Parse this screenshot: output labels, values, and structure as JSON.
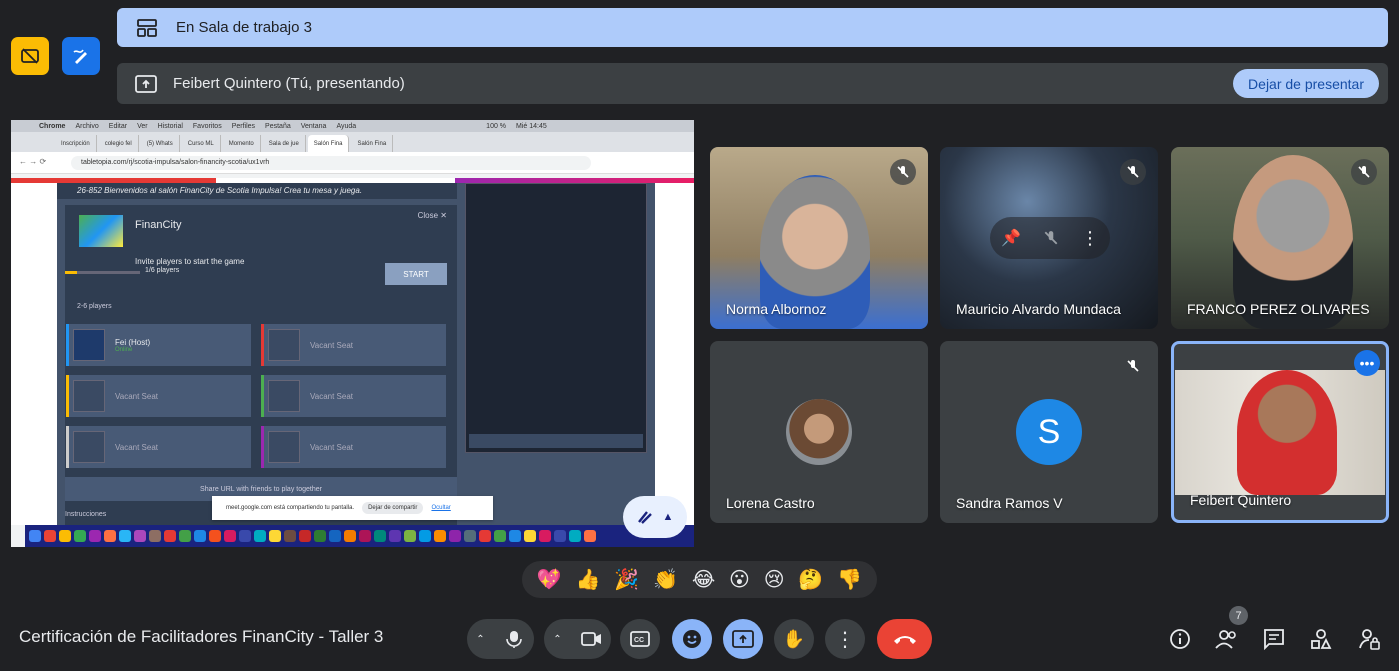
{
  "breakout": {
    "label": "En Sala de trabajo 3"
  },
  "presenting": {
    "label": "Feibert Quintero (Tú, presentando)",
    "stop_label": "Dejar de presentar"
  },
  "screen": {
    "menubar": [
      "Chrome",
      "Archivo",
      "Editar",
      "Ver",
      "Historial",
      "Favoritos",
      "Perfiles",
      "Pestaña",
      "Ventana",
      "Ayuda"
    ],
    "clock": "Mié 14:45",
    "battery": "100 %",
    "tabs": [
      "Inscripción",
      "colegio fel",
      "(5) Whats",
      "Curso ML",
      "Momento",
      "Sala de jue",
      "Salón Fina",
      "Salón Fina"
    ],
    "url": "tabletopia.com/rj/scotia-impulsa/salon-financity-scotia/ux1vrh",
    "banner": "26-852 Bienvenidos al salón FinanCity de Scotia Impulsa! Crea tu mesa y juega.",
    "game_title": "FinanCity",
    "close_label": "Close",
    "invite_text": "Invite players to start the game",
    "players_count": "1/6 players",
    "start_label": "START",
    "players_range": "2-6 players",
    "host_name": "Fei (Host)",
    "host_status": "Online",
    "vacant_label": "Vacant Seat",
    "share_url_text": "Share URL with friends to play together",
    "bottom_label": "Instrucciones",
    "share_notice": "meet.google.com está compartiendo tu pantalla.",
    "share_stop": "Dejar de compartir",
    "share_hide": "Ocultar"
  },
  "participants": [
    {
      "name": "Norma Albornoz",
      "muted": true
    },
    {
      "name": "Mauricio Alvardo Mundaca",
      "muted": true
    },
    {
      "name": "FRANCO PEREZ OLIVARES",
      "muted": true
    },
    {
      "name": "Lorena Castro",
      "muted": false
    },
    {
      "name": "Sandra Ramos V",
      "muted": true,
      "initial": "S",
      "avatar_color": "#1e88e5"
    },
    {
      "name": "Feibert Quintero",
      "muted": false
    }
  ],
  "reactions": [
    "💖",
    "👍",
    "🎉",
    "👏",
    "😂",
    "😮",
    "😢",
    "🤔",
    "👎"
  ],
  "meeting_title": "Certificación de Facilitadores FinanCity - Taller 3",
  "people_count": "7",
  "colors": {
    "accent": "#8ab4f8",
    "end_call": "#ea4335",
    "banner": "#aecbfa"
  }
}
